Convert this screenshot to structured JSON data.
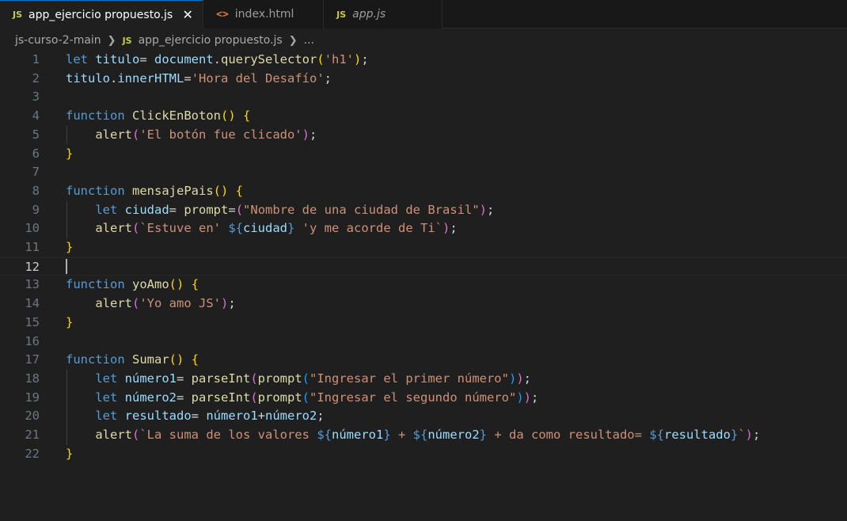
{
  "tabs": [
    {
      "icon": "JS",
      "label": "app_ejercicio propuesto.js",
      "active": true,
      "close": "✕"
    },
    {
      "icon": "<>",
      "label": "index.html",
      "active": false
    },
    {
      "icon": "JS",
      "label": "app.js",
      "active": false
    }
  ],
  "breadcrumb": {
    "folder": "js-curso-2-main",
    "file_icon": "JS",
    "file": "app_ejercicio propuesto.js",
    "more": "..."
  },
  "editor": {
    "current_line": 12,
    "lines": [
      [
        {
          "t": "let",
          "c": "kw"
        },
        {
          "t": " ",
          "c": "op"
        },
        {
          "t": "titulo",
          "c": "var"
        },
        {
          "t": "= ",
          "c": "op"
        },
        {
          "t": "document",
          "c": "var"
        },
        {
          "t": ".",
          "c": "op"
        },
        {
          "t": "querySelector",
          "c": "fn"
        },
        {
          "t": "(",
          "c": "p1"
        },
        {
          "t": "'h1'",
          "c": "str"
        },
        {
          "t": ")",
          "c": "p1"
        },
        {
          "t": ";",
          "c": "op"
        }
      ],
      [
        {
          "t": "titulo",
          "c": "var"
        },
        {
          "t": ".",
          "c": "op"
        },
        {
          "t": "innerHTML",
          "c": "var"
        },
        {
          "t": "=",
          "c": "op"
        },
        {
          "t": "'Hora del Desafío'",
          "c": "str"
        },
        {
          "t": ";",
          "c": "op"
        }
      ],
      [],
      [
        {
          "t": "function",
          "c": "kw"
        },
        {
          "t": " ",
          "c": "op"
        },
        {
          "t": "ClickEnBoton",
          "c": "fn"
        },
        {
          "t": "()",
          "c": "p1"
        },
        {
          "t": " ",
          "c": "op"
        },
        {
          "t": "{",
          "c": "p1"
        }
      ],
      [
        {
          "t": "    ",
          "c": "op"
        },
        {
          "t": "alert",
          "c": "fn"
        },
        {
          "t": "(",
          "c": "p2"
        },
        {
          "t": "'El botón fue clicado'",
          "c": "str"
        },
        {
          "t": ")",
          "c": "p2"
        },
        {
          "t": ";",
          "c": "op"
        }
      ],
      [
        {
          "t": "}",
          "c": "p1"
        }
      ],
      [],
      [
        {
          "t": "function",
          "c": "kw"
        },
        {
          "t": " ",
          "c": "op"
        },
        {
          "t": "mensajePais",
          "c": "fn"
        },
        {
          "t": "()",
          "c": "p1"
        },
        {
          "t": " ",
          "c": "op"
        },
        {
          "t": "{",
          "c": "p1"
        }
      ],
      [
        {
          "t": "    ",
          "c": "op"
        },
        {
          "t": "let",
          "c": "kw"
        },
        {
          "t": " ",
          "c": "op"
        },
        {
          "t": "ciudad",
          "c": "var"
        },
        {
          "t": "= ",
          "c": "op"
        },
        {
          "t": "prompt",
          "c": "fn"
        },
        {
          "t": "=",
          "c": "op"
        },
        {
          "t": "(",
          "c": "p2"
        },
        {
          "t": "\"Nombre de una ciudad de Brasil\"",
          "c": "str"
        },
        {
          "t": ")",
          "c": "p2"
        },
        {
          "t": ";",
          "c": "op"
        }
      ],
      [
        {
          "t": "    ",
          "c": "op"
        },
        {
          "t": "alert",
          "c": "fn"
        },
        {
          "t": "(",
          "c": "p2"
        },
        {
          "t": "`Estuve en' ",
          "c": "str"
        },
        {
          "t": "${",
          "c": "kw"
        },
        {
          "t": "ciudad",
          "c": "var"
        },
        {
          "t": "}",
          "c": "kw"
        },
        {
          "t": " 'y me acorde de Ti`",
          "c": "str"
        },
        {
          "t": ")",
          "c": "p2"
        },
        {
          "t": ";",
          "c": "op"
        }
      ],
      [
        {
          "t": "}",
          "c": "p1"
        }
      ],
      [],
      [
        {
          "t": "function",
          "c": "kw"
        },
        {
          "t": " ",
          "c": "op"
        },
        {
          "t": "yoAmo",
          "c": "fn"
        },
        {
          "t": "()",
          "c": "p1"
        },
        {
          "t": " ",
          "c": "op"
        },
        {
          "t": "{",
          "c": "p1"
        }
      ],
      [
        {
          "t": "    ",
          "c": "op"
        },
        {
          "t": "alert",
          "c": "fn"
        },
        {
          "t": "(",
          "c": "p2"
        },
        {
          "t": "'Yo amo JS'",
          "c": "str"
        },
        {
          "t": ")",
          "c": "p2"
        },
        {
          "t": ";",
          "c": "op"
        }
      ],
      [
        {
          "t": "}",
          "c": "p1"
        }
      ],
      [],
      [
        {
          "t": "function",
          "c": "kw"
        },
        {
          "t": " ",
          "c": "op"
        },
        {
          "t": "Sumar",
          "c": "fn"
        },
        {
          "t": "()",
          "c": "p1"
        },
        {
          "t": " ",
          "c": "op"
        },
        {
          "t": "{",
          "c": "p1"
        }
      ],
      [
        {
          "t": "    ",
          "c": "op"
        },
        {
          "t": "let",
          "c": "kw"
        },
        {
          "t": " ",
          "c": "op"
        },
        {
          "t": "número1",
          "c": "var"
        },
        {
          "t": "= ",
          "c": "op"
        },
        {
          "t": "parseInt",
          "c": "fn"
        },
        {
          "t": "(",
          "c": "p2"
        },
        {
          "t": "prompt",
          "c": "fn"
        },
        {
          "t": "(",
          "c": "p3"
        },
        {
          "t": "\"Ingresar el primer número\"",
          "c": "str"
        },
        {
          "t": ")",
          "c": "p3"
        },
        {
          "t": ")",
          "c": "p2"
        },
        {
          "t": ";",
          "c": "op"
        }
      ],
      [
        {
          "t": "    ",
          "c": "op"
        },
        {
          "t": "let",
          "c": "kw"
        },
        {
          "t": " ",
          "c": "op"
        },
        {
          "t": "número2",
          "c": "var"
        },
        {
          "t": "= ",
          "c": "op"
        },
        {
          "t": "parseInt",
          "c": "fn"
        },
        {
          "t": "(",
          "c": "p2"
        },
        {
          "t": "prompt",
          "c": "fn"
        },
        {
          "t": "(",
          "c": "p3"
        },
        {
          "t": "\"Ingresar el segundo número\"",
          "c": "str"
        },
        {
          "t": ")",
          "c": "p3"
        },
        {
          "t": ")",
          "c": "p2"
        },
        {
          "t": ";",
          "c": "op"
        }
      ],
      [
        {
          "t": "    ",
          "c": "op"
        },
        {
          "t": "let",
          "c": "kw"
        },
        {
          "t": " ",
          "c": "op"
        },
        {
          "t": "resultado",
          "c": "var"
        },
        {
          "t": "= ",
          "c": "op"
        },
        {
          "t": "número1",
          "c": "var"
        },
        {
          "t": "+",
          "c": "op"
        },
        {
          "t": "número2",
          "c": "var"
        },
        {
          "t": ";",
          "c": "op"
        }
      ],
      [
        {
          "t": "    ",
          "c": "op"
        },
        {
          "t": "alert",
          "c": "fn"
        },
        {
          "t": "(",
          "c": "p2"
        },
        {
          "t": "`La suma de los valores ",
          "c": "str"
        },
        {
          "t": "${",
          "c": "kw"
        },
        {
          "t": "número1",
          "c": "var"
        },
        {
          "t": "}",
          "c": "kw"
        },
        {
          "t": " + ",
          "c": "str"
        },
        {
          "t": "${",
          "c": "kw"
        },
        {
          "t": "número2",
          "c": "var"
        },
        {
          "t": "}",
          "c": "kw"
        },
        {
          "t": " + da como resultado= ",
          "c": "str"
        },
        {
          "t": "${",
          "c": "kw"
        },
        {
          "t": "resultado",
          "c": "var"
        },
        {
          "t": "}",
          "c": "kw"
        },
        {
          "t": "`",
          "c": "str"
        },
        {
          "t": ")",
          "c": "p2"
        },
        {
          "t": ";",
          "c": "op"
        }
      ],
      [
        {
          "t": "}",
          "c": "p1"
        }
      ]
    ]
  }
}
